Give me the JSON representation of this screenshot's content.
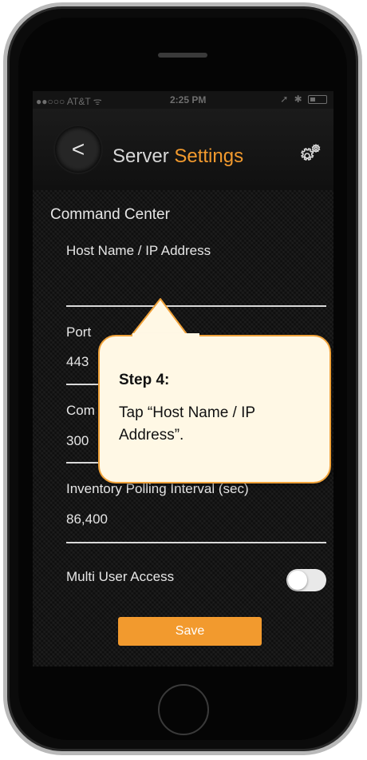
{
  "status_bar": {
    "carrier": "●●○○○ AT&T ᯤ",
    "time": "2:25 PM",
    "right": "➚ ✱"
  },
  "nav": {
    "back_glyph": "<",
    "title_main": "Server",
    "title_accent": "Settings",
    "icon": "gear-icon"
  },
  "content": {
    "section_title": "Command Center",
    "host_label": "Host Name / IP Address",
    "host_value": "",
    "port_label": "Port",
    "port_value": "443",
    "command_label_visible": "Com",
    "command_value_visible": "300",
    "inventory_label": "Inventory Polling Interval (sec)",
    "inventory_value": "86,400",
    "multi_user_label": "Multi User Access",
    "multi_user_on": false,
    "save_label": "Save"
  },
  "callout": {
    "heading": "Step 4:",
    "body": "Tap “Host Name / IP Address”."
  },
  "colors": {
    "accent": "#f29a2e",
    "callout_bg": "#fff8e5",
    "callout_border": "#f0a23a"
  }
}
